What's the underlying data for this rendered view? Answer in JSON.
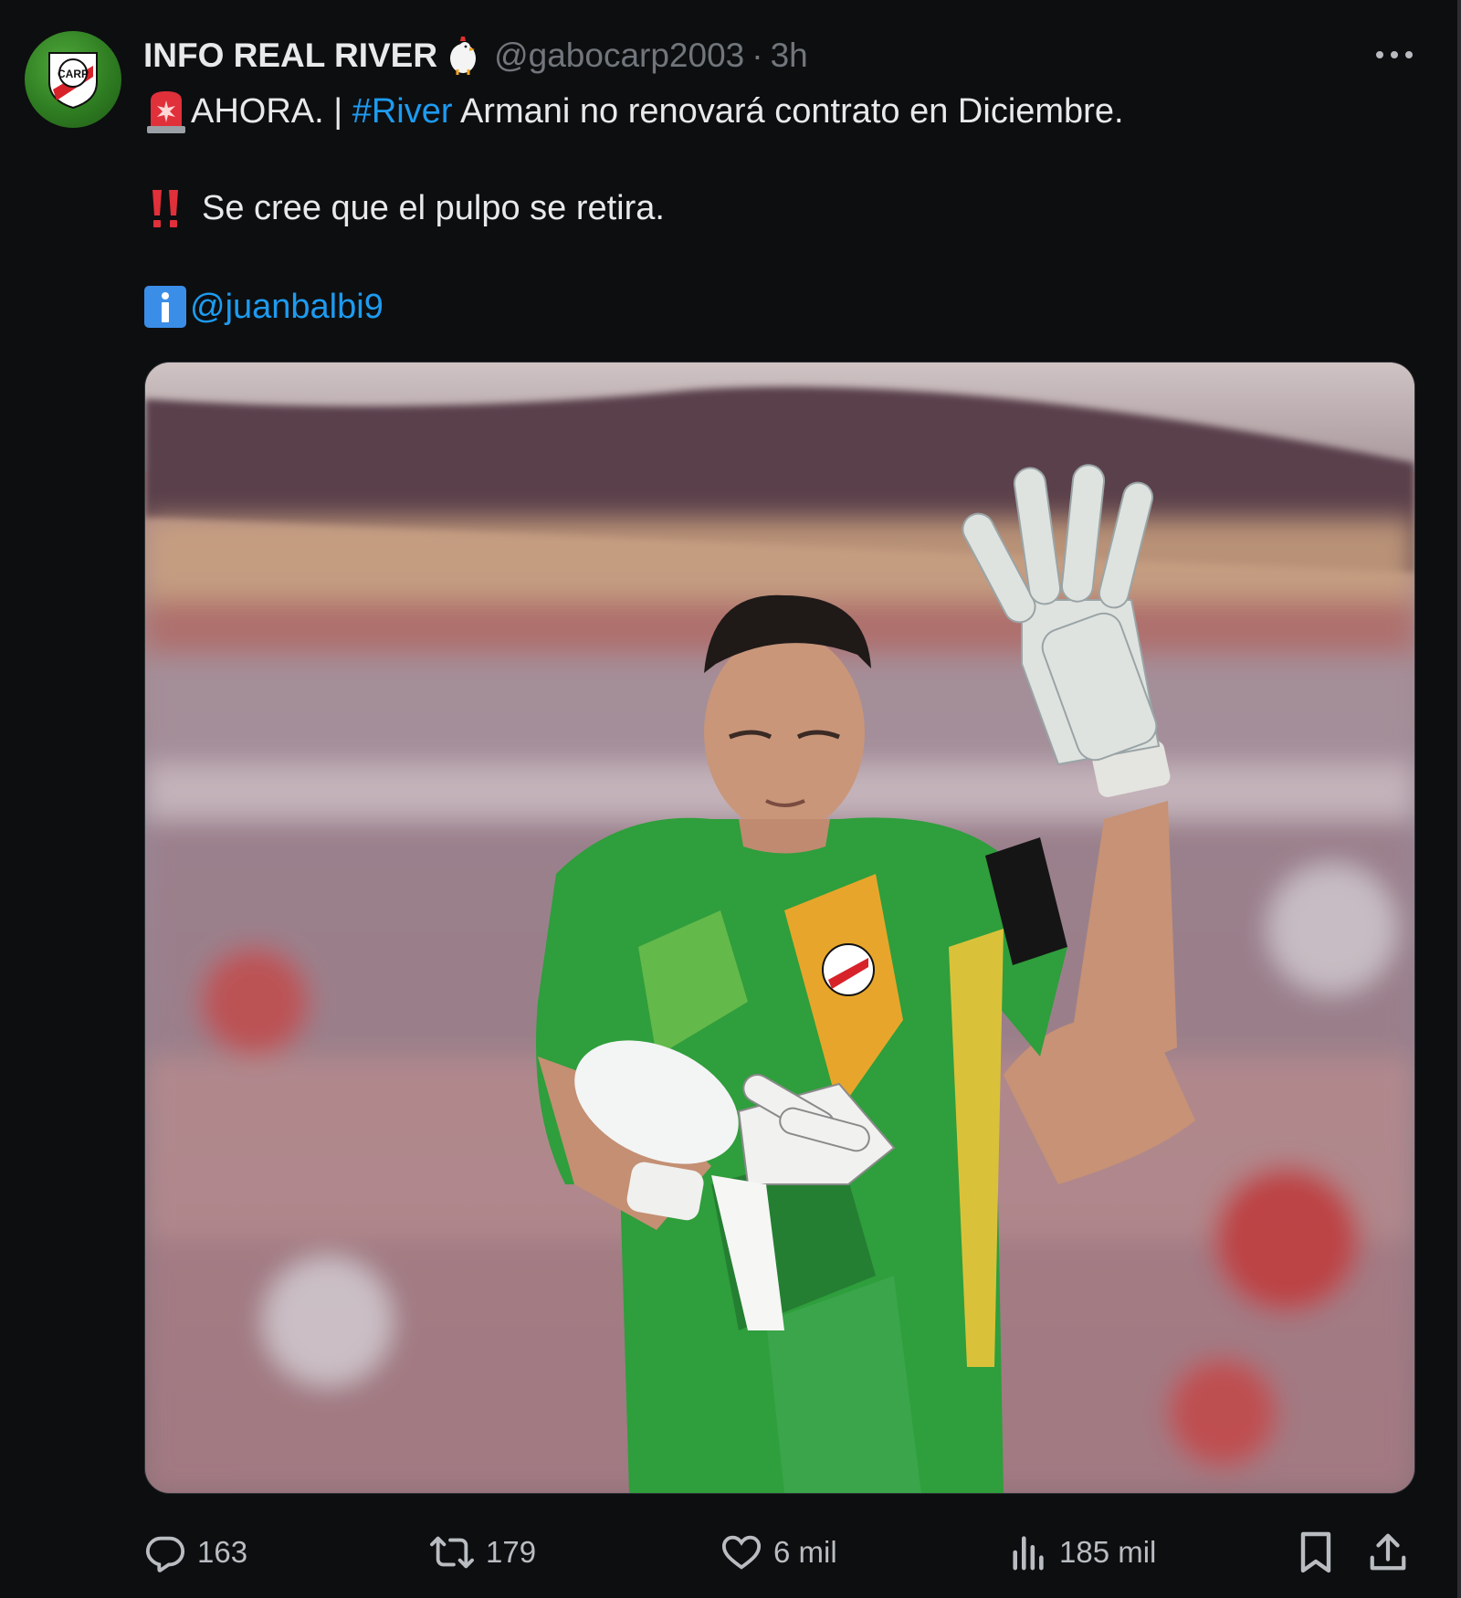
{
  "tweet": {
    "author_name": "INFO REAL RIVER",
    "handle": "@gabocarp2003",
    "separator": "·",
    "time": "3h",
    "line1_prefix": "AHORA. | ",
    "line1_hashtag": "#River",
    "line1_rest": " Armani no renovará contrato en Diciembre.",
    "line2": "Se cree que el pulpo se retira.",
    "line3_mention": "@juanbalbi9",
    "crest_text": "CARP",
    "media_alt": ""
  },
  "actions": {
    "replies": "163",
    "retweets": "179",
    "likes": "6 mil",
    "views": "185 mil"
  },
  "colors": {
    "background": "#0d0e10",
    "text": "#e7e9ea",
    "secondary": "#71767b",
    "link": "#1d9bf0",
    "jersey_green": "#2f9e3c"
  },
  "icons": [
    "verified-rooster-icon",
    "more-icon",
    "siren-icon",
    "double-exclamation-icon",
    "info-icon",
    "reply-icon",
    "retweet-icon",
    "like-icon",
    "views-icon",
    "bookmark-icon",
    "share-icon"
  ]
}
